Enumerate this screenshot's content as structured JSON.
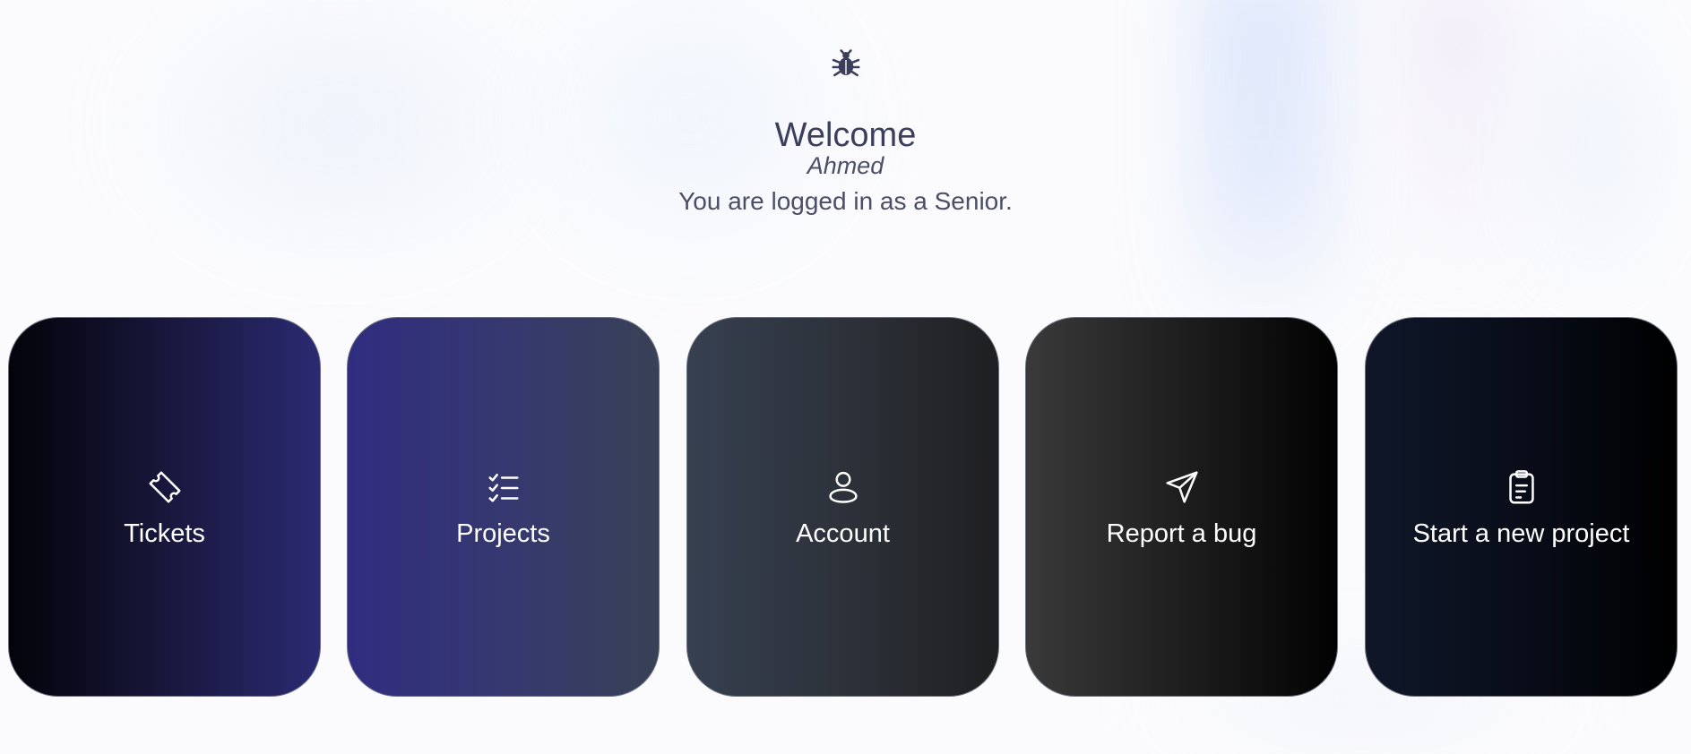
{
  "header": {
    "icon": "bug-icon",
    "welcome": "Welcome",
    "username": "Ahmed",
    "role_text": "You are logged in as a Senior."
  },
  "cards": [
    {
      "label": "Tickets",
      "icon": "ticket-icon"
    },
    {
      "label": "Projects",
      "icon": "checklist-icon"
    },
    {
      "label": "Account",
      "icon": "user-icon"
    },
    {
      "label": "Report a bug",
      "icon": "send-icon"
    },
    {
      "label": "Start a new project",
      "icon": "clipboard-icon"
    }
  ],
  "colors": {
    "heading": "#3b3f5c",
    "card_border": "#6b6f80",
    "card_text": "#ffffff"
  }
}
